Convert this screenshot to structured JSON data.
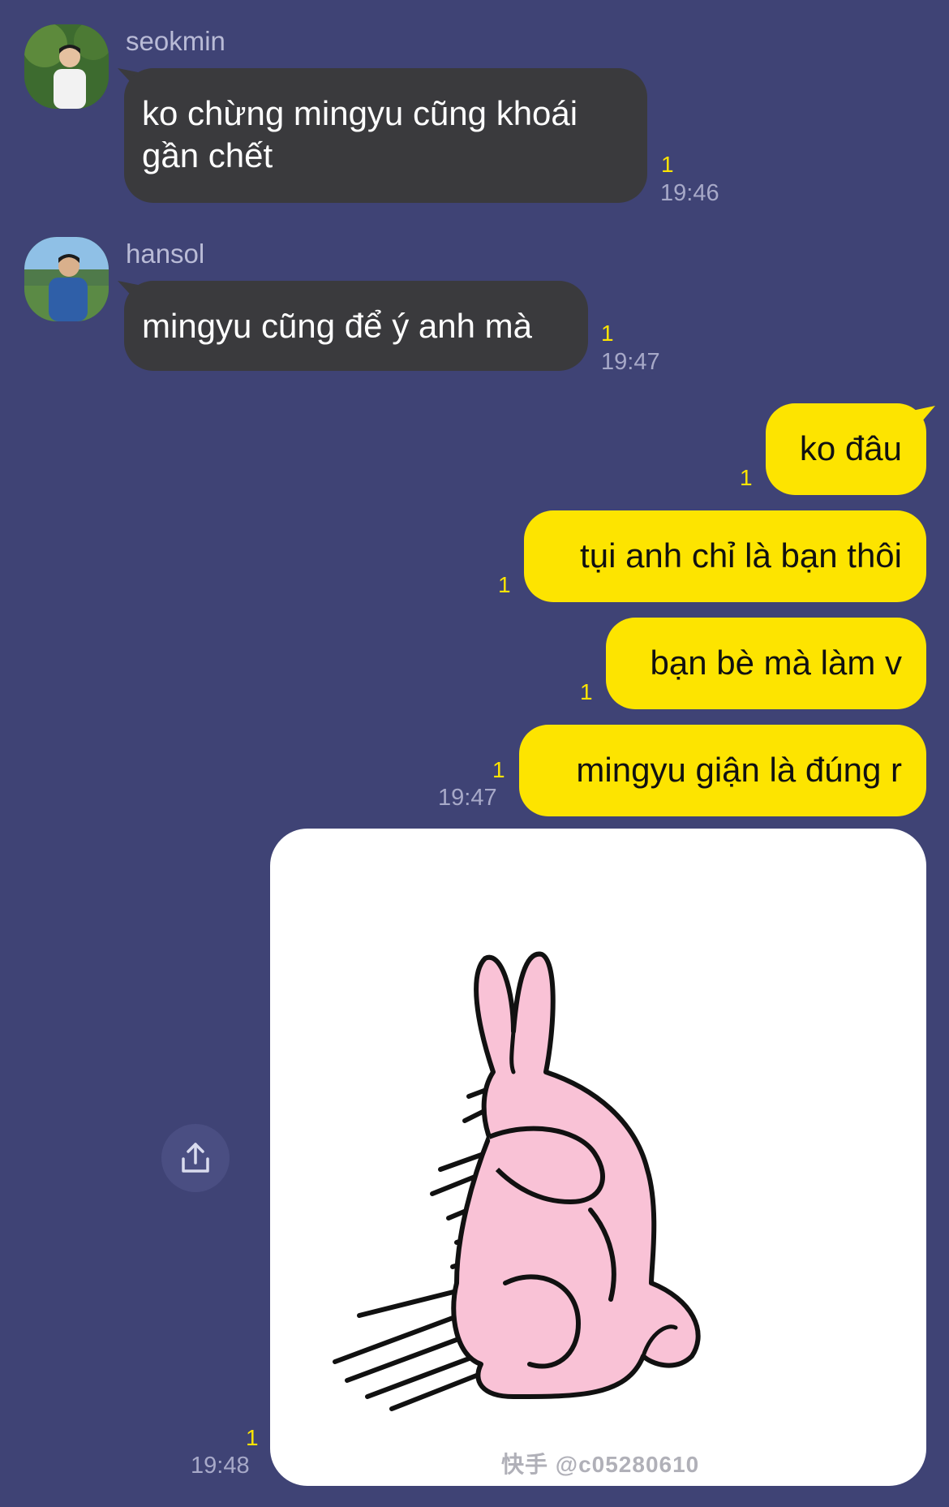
{
  "messages": {
    "seokmin": {
      "sender": "seokmin",
      "text_line1": "ko chừng mingyu cũng khoái",
      "text_line2": "gần chết",
      "unread": "1",
      "time": "19:46"
    },
    "hansol": {
      "sender": "hansol",
      "text": "mingyu cũng để ý anh mà",
      "unread": "1",
      "time": "19:47"
    },
    "outgoing": [
      {
        "text": "ko đâu",
        "unread": "1"
      },
      {
        "text": "tụi anh chỉ là bạn thôi",
        "unread": "1"
      },
      {
        "text": "bạn bè mà làm v",
        "unread": "1"
      },
      {
        "text": "mingyu giận là đúng r",
        "unread": "1",
        "time": "19:47"
      }
    ],
    "sticker": {
      "unread": "1",
      "time": "19:48",
      "watermark": "快手 @c05280610"
    }
  },
  "icons": {
    "share": "share-icon"
  },
  "colors": {
    "background": "#3f4375",
    "incoming_bubble": "#3a3a3d",
    "outgoing_bubble": "#fde400",
    "unread_count": "#fde400",
    "timestamp": "#a7a9c8"
  }
}
